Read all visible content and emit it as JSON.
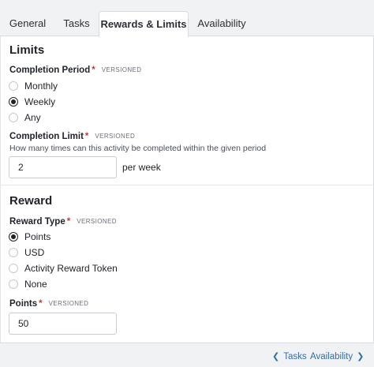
{
  "tabs": [
    {
      "label": "General",
      "active": false
    },
    {
      "label": "Tasks",
      "active": false
    },
    {
      "label": "Rewards & Limits",
      "active": true
    },
    {
      "label": "Availability",
      "active": false
    }
  ],
  "limits": {
    "heading": "Limits",
    "completion_period": {
      "label": "Completion Period",
      "required_mark": "*",
      "badge": "VERSIONED",
      "options": [
        {
          "label": "Monthly",
          "checked": false
        },
        {
          "label": "Weekly",
          "checked": true
        },
        {
          "label": "Any",
          "checked": false
        }
      ]
    },
    "completion_limit": {
      "label": "Completion Limit",
      "required_mark": "*",
      "badge": "VERSIONED",
      "help": "How many times can this activity be completed within the given period",
      "value": "2",
      "suffix": "per week"
    }
  },
  "reward": {
    "heading": "Reward",
    "reward_type": {
      "label": "Reward Type",
      "required_mark": "*",
      "badge": "VERSIONED",
      "options": [
        {
          "label": "Points",
          "checked": true
        },
        {
          "label": "USD",
          "checked": false
        },
        {
          "label": "Activity Reward Token",
          "checked": false
        },
        {
          "label": "None",
          "checked": false
        }
      ]
    },
    "points": {
      "label": "Points",
      "required_mark": "*",
      "badge": "VERSIONED",
      "value": "50"
    }
  },
  "footer": {
    "prev_label": "Tasks",
    "next_label": "Availability",
    "prev_icon": "chevron-left-icon",
    "next_icon": "chevron-right-icon",
    "link_color": "#2f6fb0"
  }
}
